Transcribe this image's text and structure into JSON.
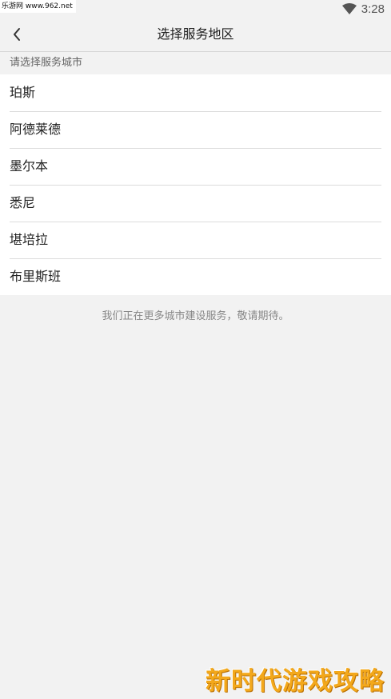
{
  "status_bar": {
    "watermark": "乐游网 www.962.net",
    "time": "3:28"
  },
  "header": {
    "title": "选择服务地区",
    "back_icon": "chevron-left-icon"
  },
  "section": {
    "label": "请选择服务城市"
  },
  "cities": [
    {
      "label": "珀斯"
    },
    {
      "label": "阿德莱德"
    },
    {
      "label": "墨尔本"
    },
    {
      "label": "悉尼"
    },
    {
      "label": "堪培拉"
    },
    {
      "label": "布里斯班"
    }
  ],
  "footer": {
    "note": "我们正在更多城市建设服务，敬请期待。"
  },
  "watermark_bottom": "新时代游戏攻略",
  "colors": {
    "background": "#f2f2f2",
    "list_background": "#ffffff",
    "watermark_orange": "#f3a81b"
  }
}
